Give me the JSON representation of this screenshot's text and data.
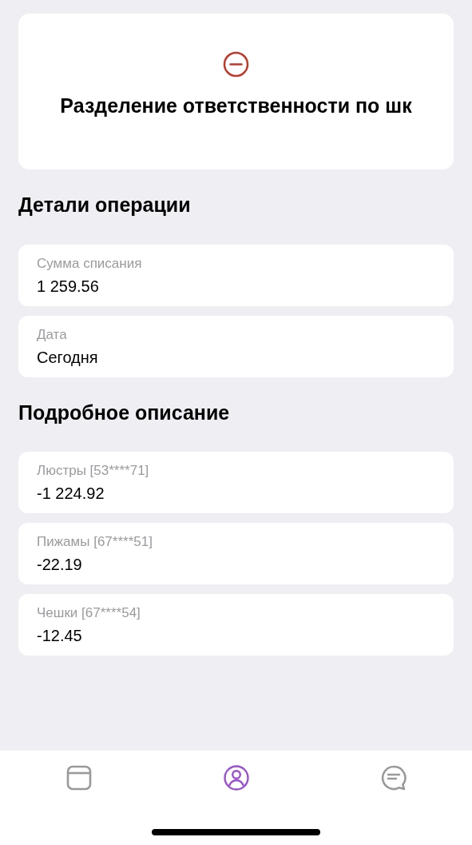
{
  "header": {
    "title": "Разделение ответственности по шк"
  },
  "details": {
    "heading": "Детали операции",
    "fields": [
      {
        "label": "Сумма списания",
        "value": "1 259.56"
      },
      {
        "label": "Дата",
        "value": "Сегодня"
      }
    ]
  },
  "description": {
    "heading": "Подробное описание",
    "items": [
      {
        "label": "Люстры [53****71]",
        "value": "-1 224.92"
      },
      {
        "label": "Пижамы [67****51]",
        "value": "-22.19"
      },
      {
        "label": "Чешки [67****54]",
        "value": "-12.45"
      }
    ]
  },
  "tab_bar": [
    {
      "kind": "window",
      "selected": false
    },
    {
      "kind": "profile",
      "selected": true
    },
    {
      "kind": "chat",
      "selected": false
    }
  ]
}
